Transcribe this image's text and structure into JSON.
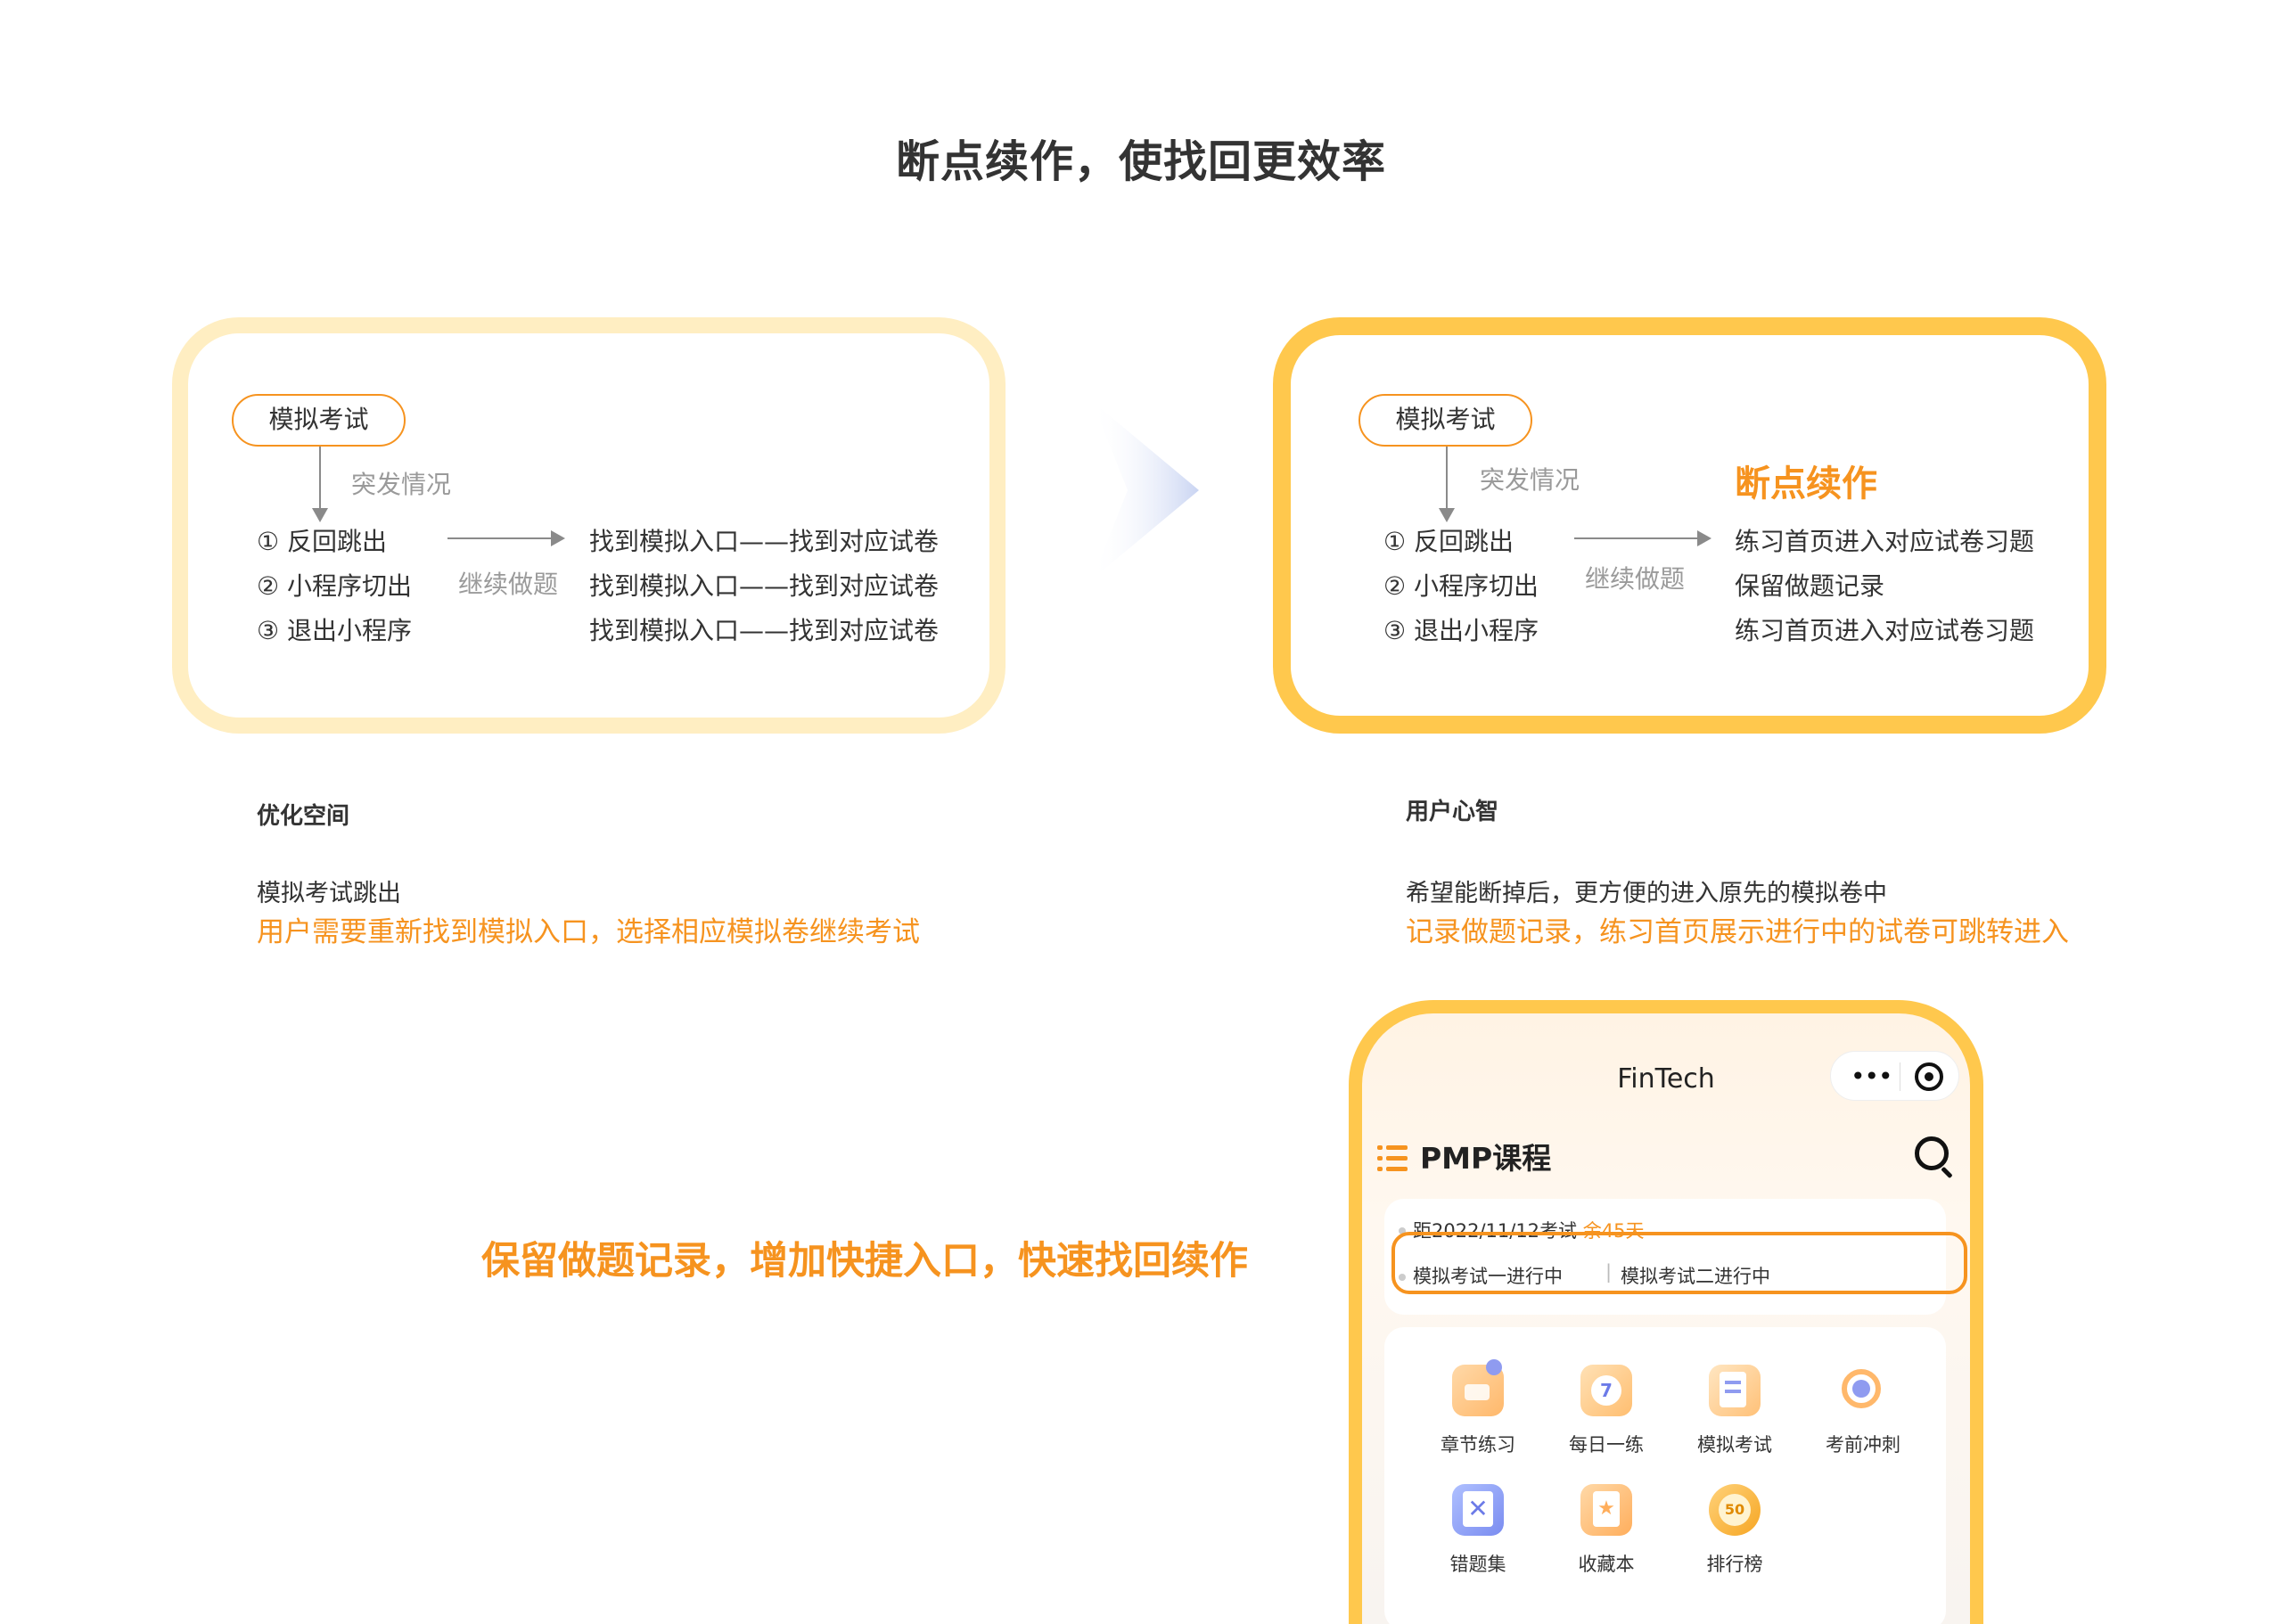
{
  "title": "断点续作，使找回更效率",
  "left_panel": {
    "pill": "模拟考试",
    "event_label": "突发情况",
    "items": [
      "① 反回跳出",
      "② 小程序切出",
      "③ 退出小程序"
    ],
    "arrow_label": "继续做题",
    "results": [
      "找到模拟入口——找到对应试卷",
      "找到模拟入口——找到对应试卷",
      "找到模拟入口——找到对应试卷"
    ]
  },
  "right_panel": {
    "pill": "模拟考试",
    "event_label": "突发情况",
    "highlight": "断点续作",
    "items": [
      "① 反回跳出",
      "② 小程序切出",
      "③ 退出小程序"
    ],
    "arrow_label": "继续做题",
    "results": [
      "练习首页进入对应试卷习题",
      "保留做题记录",
      "练习首页进入对应试卷习题"
    ]
  },
  "left_section": {
    "heading": "优化空间",
    "subheading": "模拟考试跳出",
    "highlight": "用户需要重新找到模拟入口，选择相应模拟卷继续考试"
  },
  "right_section": {
    "heading": "用户心智",
    "subheading": "希望能断掉后，更方便的进入原先的模拟卷中",
    "highlight": "记录做题记录，练习首页展示进行中的试卷可跳转进入"
  },
  "bottom_text": "保留做题记录，增加快捷入口，快速找回续作",
  "phone": {
    "app_title": "FinTech",
    "capsule_dots": "•••",
    "course_title": "PMP课程",
    "exam_date": "距2022/11/12考试",
    "days_left": "余45天",
    "in_progress": [
      "模拟考试一进行中",
      "模拟考试二进行中"
    ],
    "separator": "|",
    "tiles": [
      {
        "label": "章节练习",
        "icon": "folder-chat-icon"
      },
      {
        "label": "每日一练",
        "icon": "calendar-icon",
        "badge": "7"
      },
      {
        "label": "模拟考试",
        "icon": "exam-paper-icon"
      },
      {
        "label": "考前冲刺",
        "icon": "target-icon"
      },
      {
        "label": "错题集",
        "icon": "wrong-questions-icon"
      },
      {
        "label": "收藏本",
        "icon": "favorites-icon"
      },
      {
        "label": "排行榜",
        "icon": "ranking-medal-icon",
        "badge": "50"
      }
    ]
  },
  "colors": {
    "accent": "#F6931F",
    "panel_left_border": "#FFEEC2",
    "panel_right_border": "#FFC84D"
  }
}
